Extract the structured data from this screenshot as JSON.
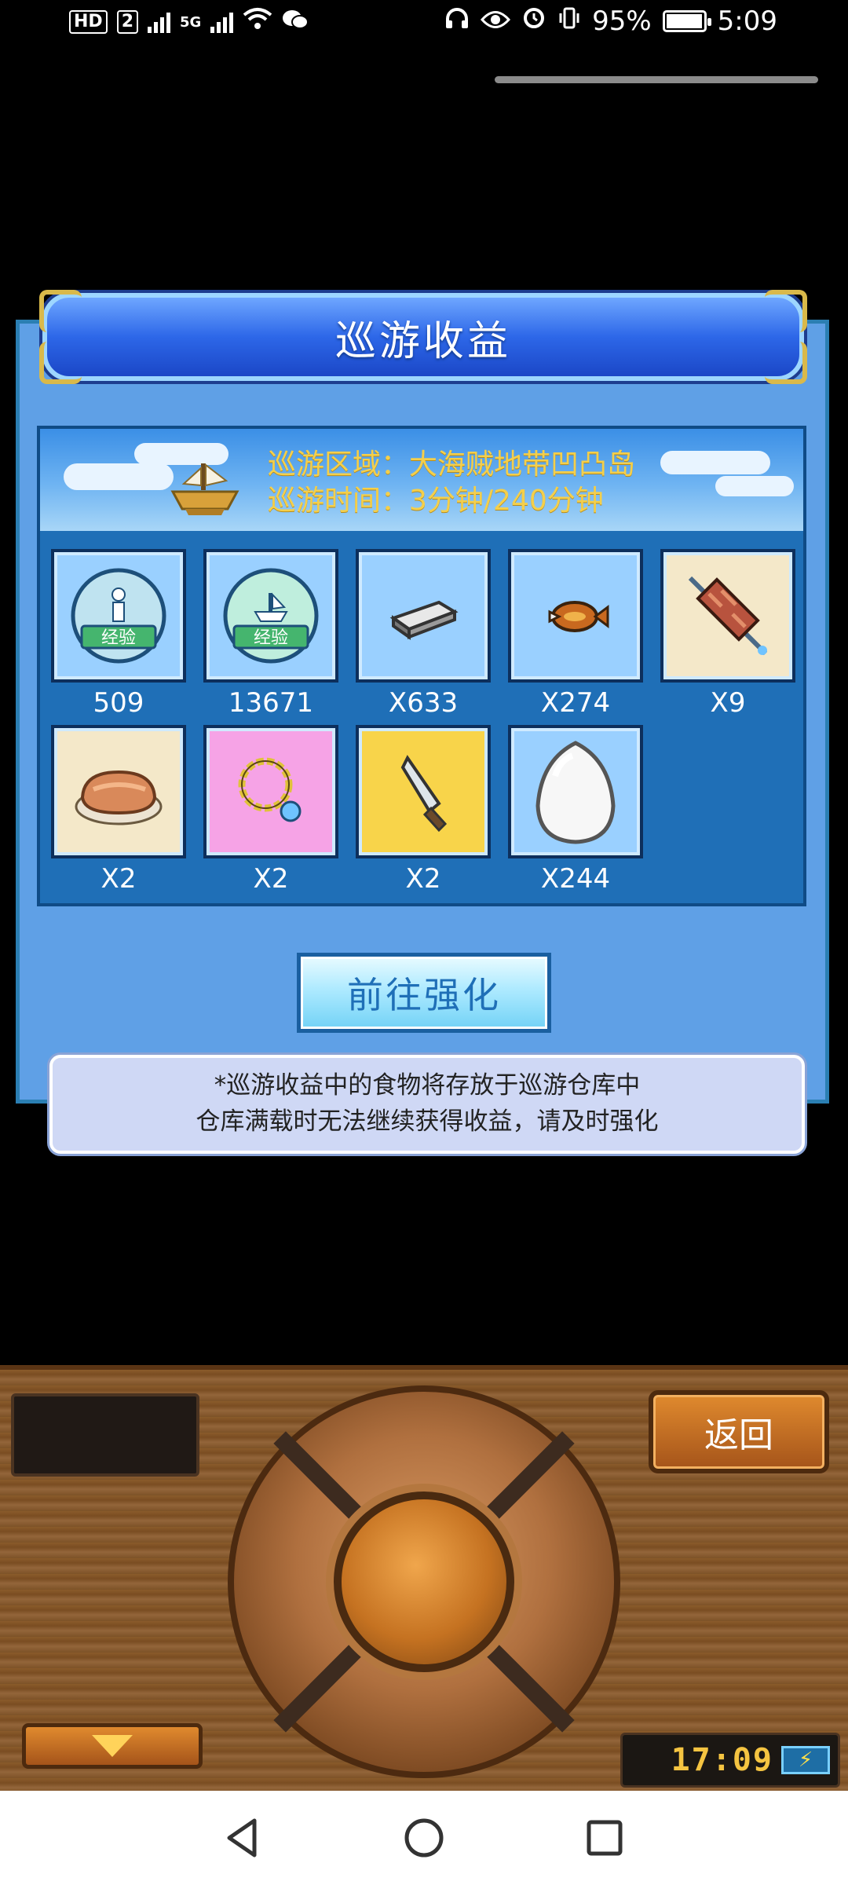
{
  "status_bar": {
    "left_chips": [
      "HD",
      "2"
    ],
    "signal_label": "5G",
    "battery_percent": "95%",
    "time": "5:09"
  },
  "dialog": {
    "title": "巡游收益",
    "region_label": "巡游区域：大海贼地带凹凸岛",
    "time_label": "巡游时间：3分钟/240分钟",
    "items": [
      {
        "name": "exp-person",
        "label": "509"
      },
      {
        "name": "exp-ship",
        "label": "13671"
      },
      {
        "name": "iron-bar",
        "label": "X633"
      },
      {
        "name": "fish",
        "label": "X274"
      },
      {
        "name": "meat-skewer",
        "label": "X9"
      },
      {
        "name": "steak-plate",
        "label": "X2"
      },
      {
        "name": "necklace",
        "label": "X2"
      },
      {
        "name": "knife",
        "label": "X2"
      },
      {
        "name": "egg",
        "label": "X244"
      }
    ],
    "go_button": "前往强化",
    "notice_line1": "*巡游收益中的食物将存放于巡游仓库中",
    "notice_line2": "仓库满载时无法继续获得收益，请及时强化"
  },
  "controller": {
    "back_button": "返回",
    "clock": "17:09"
  }
}
